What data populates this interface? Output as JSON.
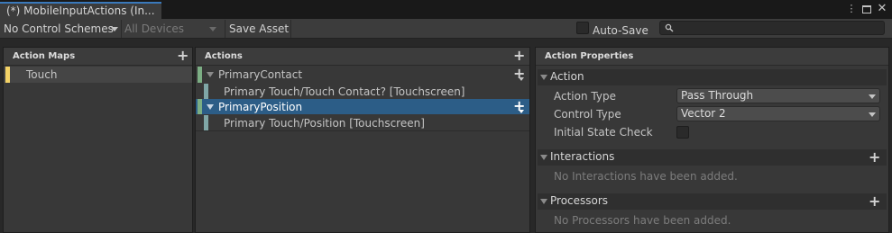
{
  "window": {
    "tab_title": "(*) MobileInputActions (In...",
    "more_icon": "more-vert-icon",
    "maximize_icon": "maximize-icon",
    "close_icon": "close-icon"
  },
  "toolbar": {
    "control_schemes": "No Control Schemes",
    "devices": "All Devices",
    "save_asset": "Save Asset",
    "auto_save": "Auto-Save",
    "auto_save_checked": false,
    "search_placeholder": ""
  },
  "action_maps": {
    "header": "Action Maps",
    "items": [
      {
        "label": "Touch",
        "accent": "#f3d266"
      }
    ]
  },
  "actions": {
    "header": "Actions",
    "items": [
      {
        "label": "PrimaryContact",
        "accent": "#7cae84",
        "selected": false,
        "bindings": [
          {
            "label": "Primary Touch/Touch Contact? [Touchscreen]",
            "accent": "#7fa6a6"
          }
        ]
      },
      {
        "label": "PrimaryPosition",
        "accent": "#7cae84",
        "selected": true,
        "bindings": [
          {
            "label": "Primary Touch/Position [Touchscreen]",
            "accent": "#7fa6a6"
          }
        ]
      }
    ]
  },
  "properties": {
    "header": "Action Properties",
    "action_section": "Action",
    "action_type_label": "Action Type",
    "action_type_value": "Pass Through",
    "control_type_label": "Control Type",
    "control_type_value": "Vector 2",
    "initial_state_label": "Initial State Check",
    "initial_state_checked": false,
    "interactions_section": "Interactions",
    "interactions_empty": "No Interactions have been added.",
    "processors_section": "Processors",
    "processors_empty": "No Processors have been added."
  },
  "colors": {
    "selection": "#2c5d87",
    "tab_accent": "#3a79bb"
  }
}
